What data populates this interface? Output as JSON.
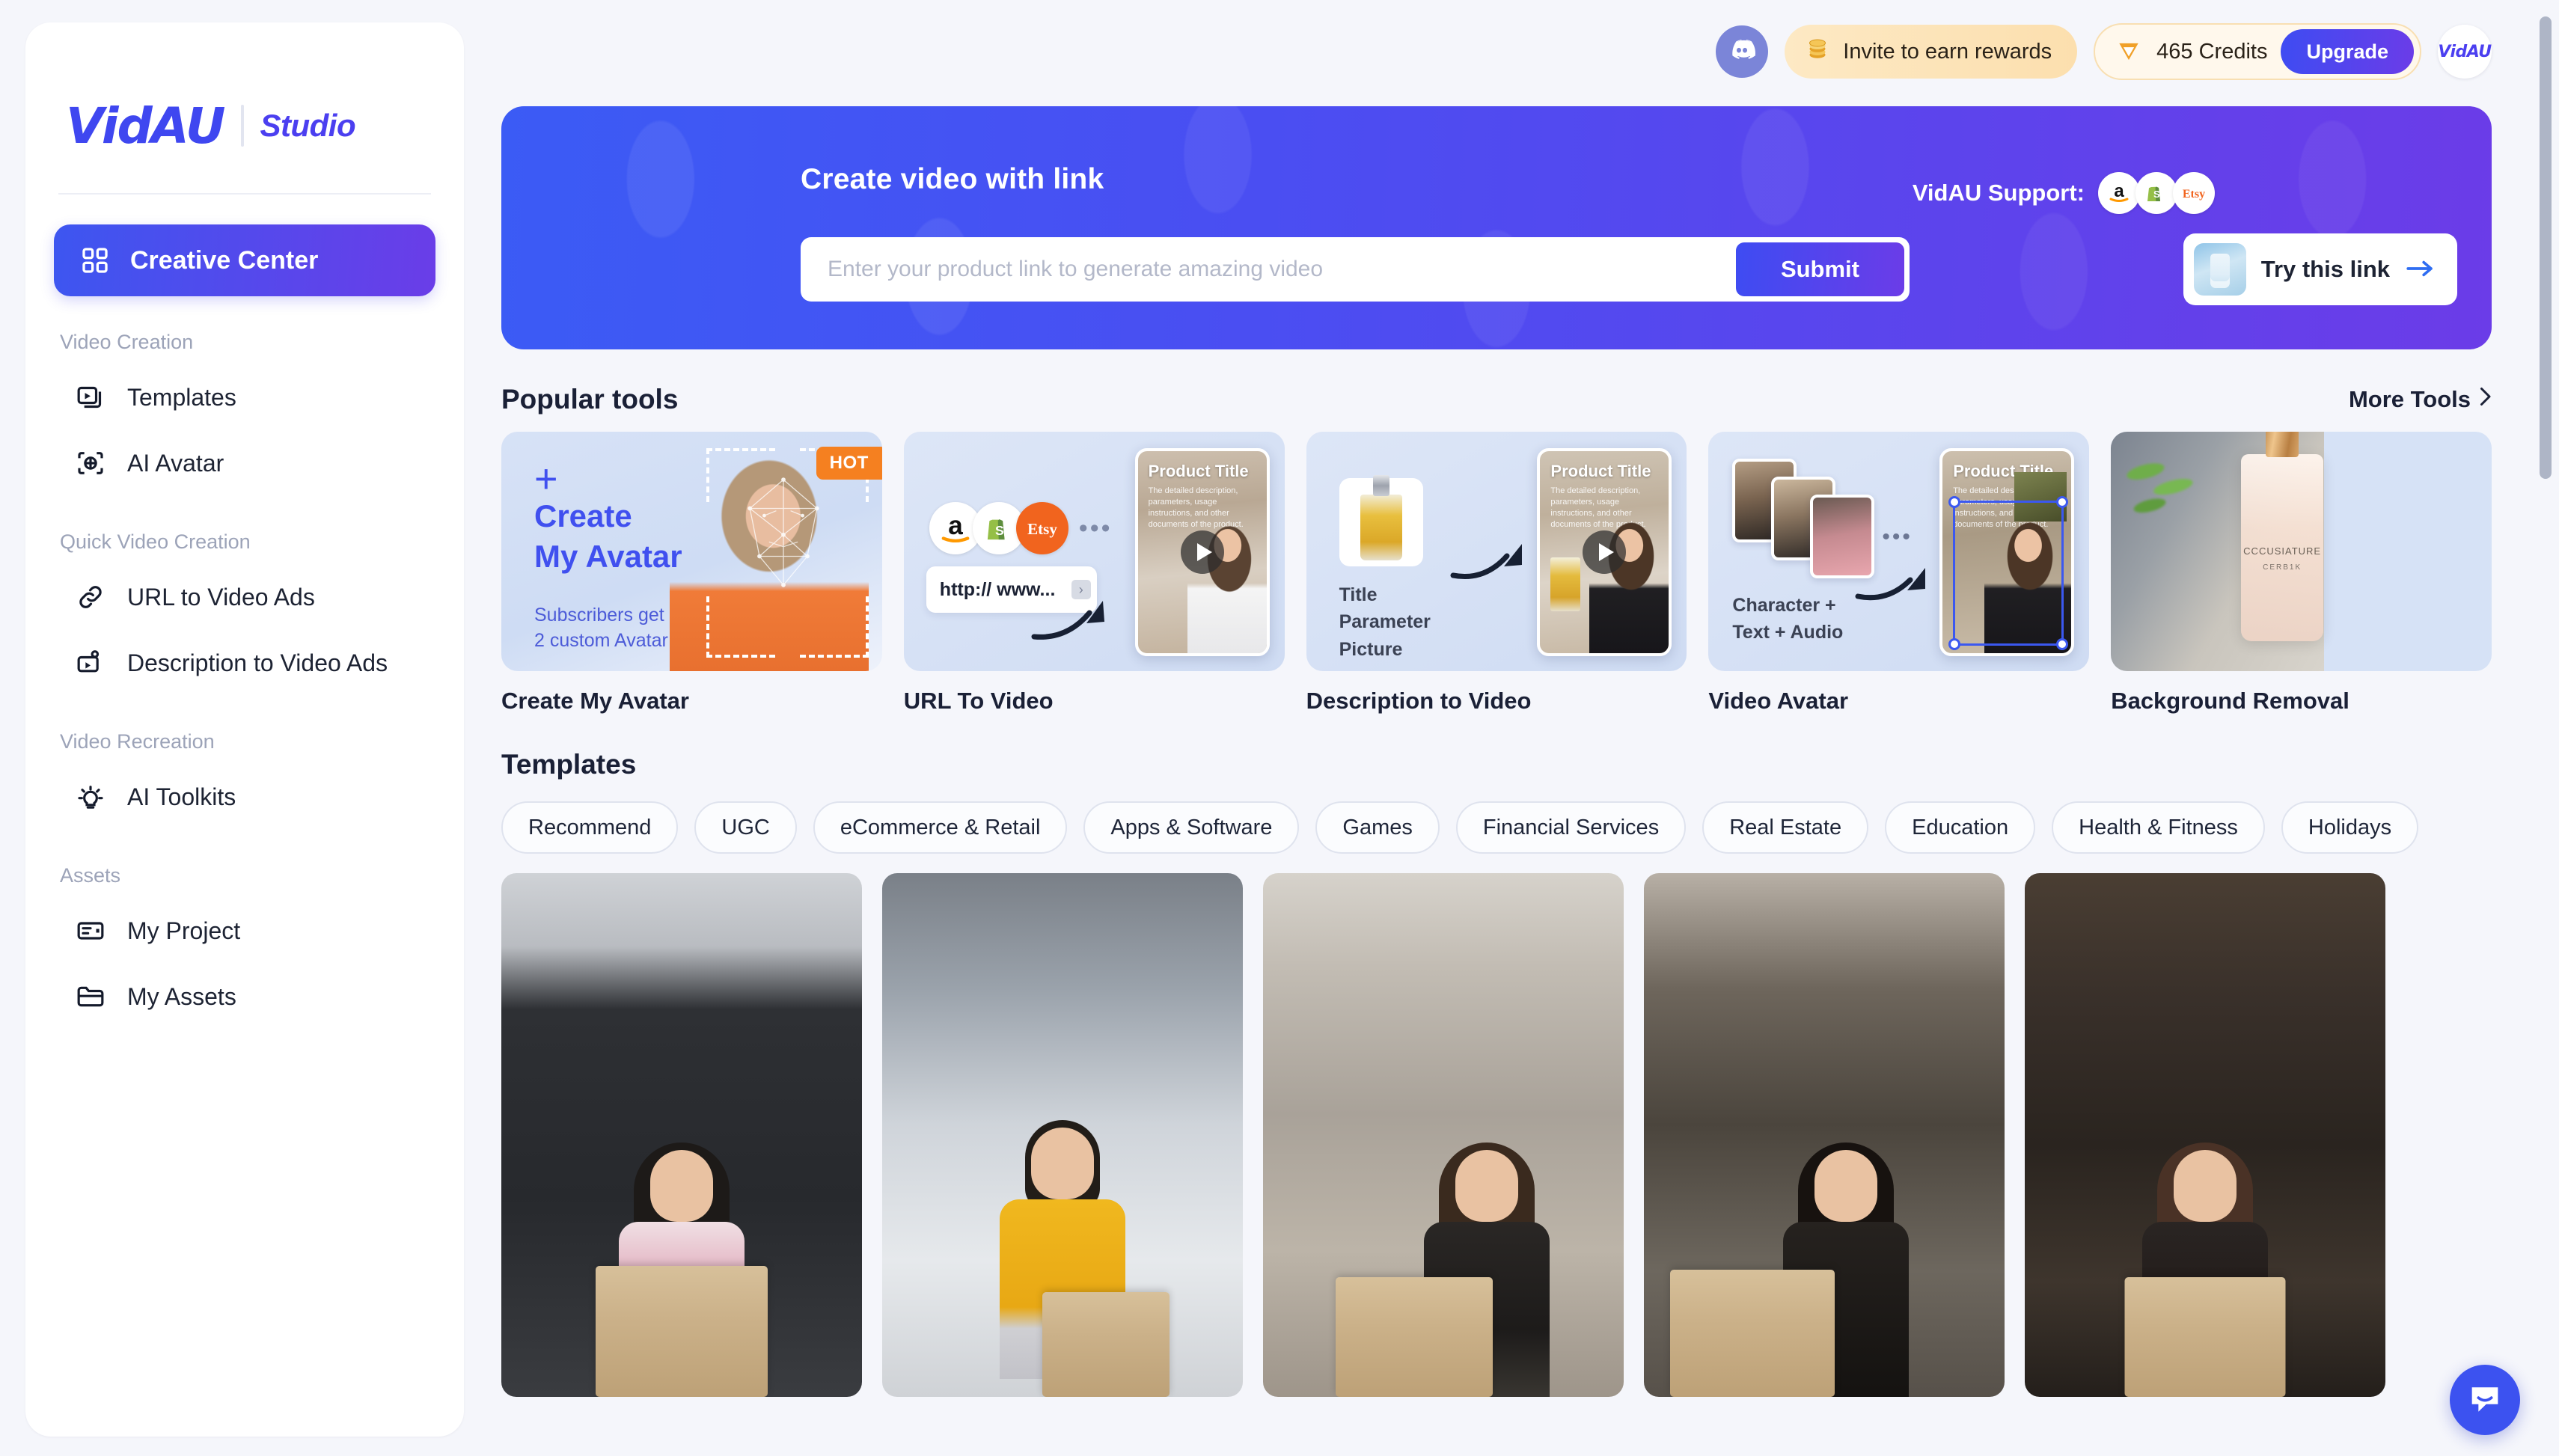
{
  "brand": {
    "logo": "VidAU",
    "product": "Studio",
    "accent": "#4b3ff0"
  },
  "sidebar": {
    "active": {
      "label": "Creative Center",
      "icon": "grid-icon"
    },
    "groups": [
      {
        "label": "Video Creation",
        "items": [
          {
            "label": "Templates",
            "icon": "templates-icon"
          },
          {
            "label": "AI Avatar",
            "icon": "ai-avatar-icon"
          }
        ]
      },
      {
        "label": "Quick Video Creation",
        "items": [
          {
            "label": "URL to Video Ads",
            "icon": "link-icon"
          },
          {
            "label": "Description to Video Ads",
            "icon": "description-video-icon"
          }
        ]
      },
      {
        "label": "Video Recreation",
        "items": [
          {
            "label": "AI Toolkits",
            "icon": "lightbulb-icon"
          }
        ]
      },
      {
        "label": "Assets",
        "items": [
          {
            "label": "My Project",
            "icon": "project-icon"
          },
          {
            "label": "My Assets",
            "icon": "folder-icon"
          }
        ]
      }
    ]
  },
  "header": {
    "discord_icon": "discord-icon",
    "invite_label": "Invite to earn rewards",
    "invite_icon": "coins-icon",
    "credits_label": "465 Credits",
    "credits_icon": "gem-icon",
    "upgrade_label": "Upgrade",
    "avatar_label": "VidAU"
  },
  "hero": {
    "title": "Create video with link",
    "input_placeholder": "Enter your product link to generate amazing video",
    "input_value": "",
    "submit_label": "Submit",
    "support_label": "VidAU Support:",
    "support_logos": [
      "amazon-logo",
      "shopify-logo",
      "etsy-logo"
    ],
    "try_link_label": "Try this link",
    "try_link_icon": "arrow-right-icon",
    "gradient_from": "#3b5bf5",
    "gradient_to": "#6b3ce8"
  },
  "popular_tools": {
    "title": "Popular tools",
    "more_label": "More Tools",
    "cards": [
      {
        "label": "Create My Avatar",
        "badge": "HOT",
        "overlay": {
          "plus": "+",
          "line1": "Create",
          "line2": "My Avatar",
          "sub1": "Subscribers get",
          "sub2": "2 custom Avatar"
        }
      },
      {
        "label": "URL To Video",
        "overlay": {
          "url": "http:// www...",
          "dots": "•••",
          "phone_title": "Product Title",
          "phone_desc": "The detailed description, parameters, usage instructions, and other documents of the product."
        }
      },
      {
        "label": "Description to Video",
        "overlay": {
          "caption1": "Title",
          "caption2": "Parameter",
          "caption3": "Picture",
          "phone_title": "Product Title",
          "phone_desc": "The detailed description, parameters, usage instructions, and other documents of the product."
        }
      },
      {
        "label": "Video Avatar",
        "overlay": {
          "caption1": "Character +",
          "caption2": "Text + Audio",
          "dots": "•••",
          "phone_title": "Product Title",
          "phone_desc": "The detailed description, parameters, usage instructions, and other documents of the product."
        }
      },
      {
        "label": "Background Removal",
        "overlay": {
          "brand": "CCCUSIATURE",
          "brand2": "CERB1K"
        }
      }
    ]
  },
  "templates": {
    "title": "Templates",
    "categories": [
      "Recommend",
      "UGC",
      "eCommerce & Retail",
      "Apps & Software",
      "Games",
      "Financial Services",
      "Real Estate",
      "Education",
      "Health & Fitness",
      "Holidays"
    ],
    "active_category": "Recommend",
    "items": [
      {
        "name": "template-thumb-1"
      },
      {
        "name": "template-thumb-2"
      },
      {
        "name": "template-thumb-3"
      },
      {
        "name": "template-thumb-4"
      },
      {
        "name": "template-thumb-5"
      }
    ]
  },
  "chat": {
    "icon": "chat-bubble-icon",
    "color": "#3c52f0"
  }
}
